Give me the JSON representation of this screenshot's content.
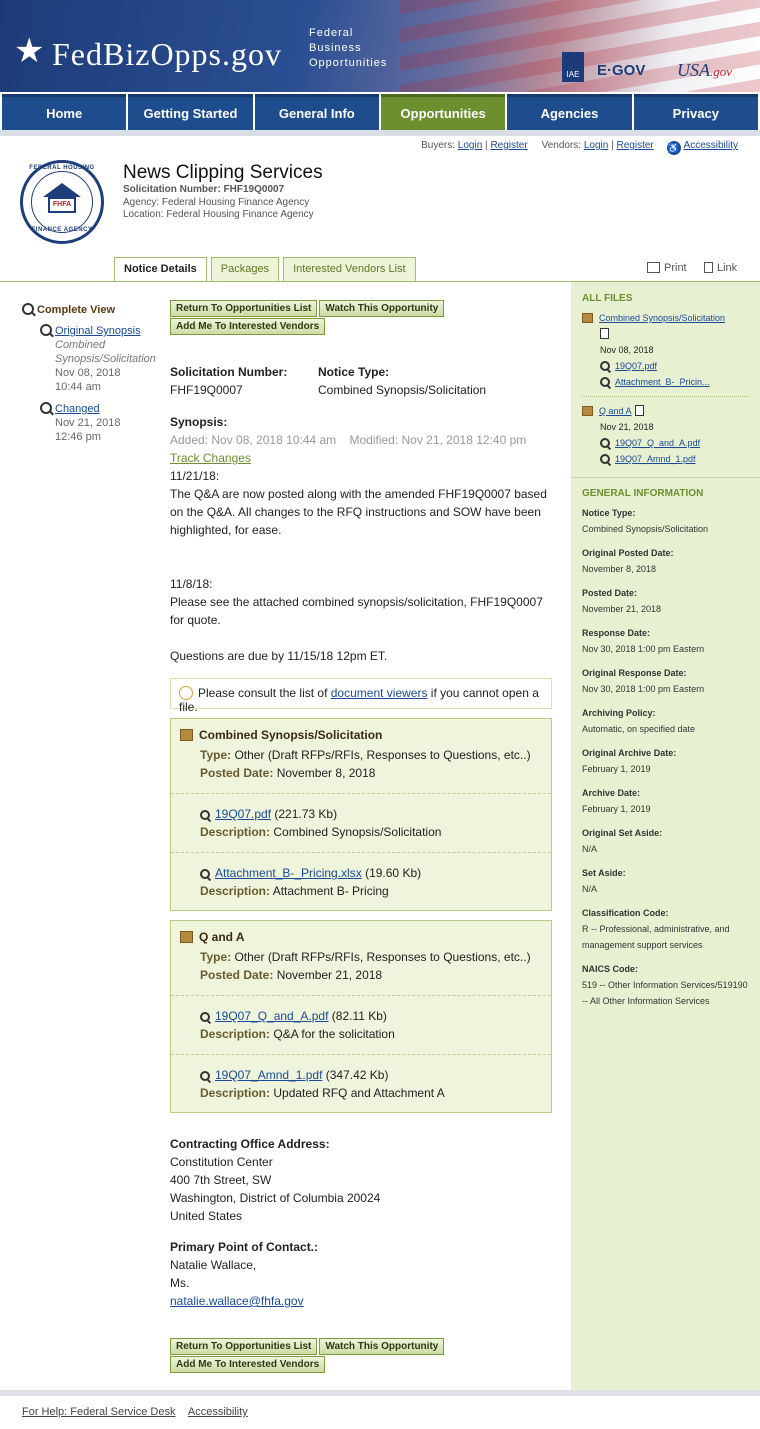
{
  "header": {
    "logo_text": "FedBizOpps.gov",
    "logo_sub": [
      "Federal",
      "Business",
      "Opportunities"
    ],
    "iae": "IAE",
    "egov": "E·GOV",
    "usagov": "USA",
    "usagov_suffix": ".gov",
    "colors": {
      "brand_blue": "#1e4d8e",
      "accent_green": "#6c8f2f"
    }
  },
  "nav": [
    "Home",
    "Getting Started",
    "General Info",
    "Opportunities",
    "Agencies",
    "Privacy"
  ],
  "top_links": {
    "buyers_label": "Buyers:",
    "vendors_label": "Vendors:",
    "login": "Login",
    "register": "Register",
    "sep": "|",
    "accessibility": "Accessibility"
  },
  "notice": {
    "title": "News Clipping Services",
    "solicitation_line": "Solicitation Number: FHF19Q0007",
    "agency_line": "Agency: Federal Housing Finance Agency",
    "location_line": "Location: Federal Housing Finance Agency",
    "seal_top": "FEDERAL HOUSING",
    "seal_bottom": "FINANCE AGENCY",
    "seal_center": "FHFA"
  },
  "tabs": [
    "Notice Details",
    "Packages",
    "Interested Vendors List"
  ],
  "tools": {
    "print": "Print",
    "link": "Link"
  },
  "left": {
    "complete_view": "Complete View",
    "items": [
      {
        "link": "Original Synopsis",
        "sub": "Combined Synopsis/Solicitation",
        "date": "Nov 08, 2018",
        "time": "10:44 am"
      },
      {
        "link": "Changed",
        "date": "Nov 21, 2018",
        "time": "12:46 pm"
      }
    ]
  },
  "buttons": {
    "return": "Return To Opportunities List",
    "watch": "Watch This Opportunity",
    "add": "Add Me To Interested Vendors"
  },
  "main": {
    "sol_label": "Solicitation Number:",
    "sol_value": "FHF19Q0007",
    "type_label": "Notice Type:",
    "type_value": "Combined Synopsis/Solicitation",
    "synopsis_label": "Synopsis:",
    "added": "Added: Nov 08, 2018 10:44 am",
    "modified": "Modified: Nov 21, 2018 12:40 pm",
    "track_changes": "Track Changes",
    "p1_date": "11/21/18:",
    "p1": "The Q&A are now posted along with the amended FHF19Q0007 based on the Q&A. All changes to the RFQ instructions and SOW have been highlighted, for ease.",
    "p2_date": "11/8/18:",
    "p2": "Please see the attached combined synopsis/solicitation, FHF19Q0007 for quote.",
    "p3": "Questions are due by 11/15/18 12pm ET.",
    "tip_before": "Please consult the list of ",
    "tip_link": "document viewers",
    "tip_after": " if you cannot open a file.",
    "packages": [
      {
        "title": "Combined Synopsis/Solicitation",
        "type_label": "Type:",
        "type_value": "Other (Draft RFPs/RFIs, Responses to Questions, etc..)",
        "date_label": "Posted Date:",
        "date_value": "November 8, 2018",
        "files": [
          {
            "name": "19Q07.pdf",
            "size": "(221.73 Kb)",
            "desc_label": "Description:",
            "desc": "Combined Synopsis/Solicitation"
          },
          {
            "name": "Attachment_B-_Pricing.xlsx",
            "size": "(19.60 Kb)",
            "desc_label": "Description:",
            "desc": "Attachment B- Pricing"
          }
        ]
      },
      {
        "title": "Q and A",
        "type_label": "Type:",
        "type_value": "Other (Draft RFPs/RFIs, Responses to Questions, etc..)",
        "date_label": "Posted Date:",
        "date_value": "November 21, 2018",
        "files": [
          {
            "name": "19Q07_Q_and_A.pdf",
            "size": "(82.11 Kb)",
            "desc_label": "Description:",
            "desc": "Q&A for the solicitation"
          },
          {
            "name": "19Q07_Amnd_1.pdf",
            "size": "(347.42 Kb)",
            "desc_label": "Description:",
            "desc": "Updated RFQ and Attachment A"
          }
        ]
      }
    ],
    "office_label": "Contracting Office Address:",
    "office_lines": [
      "Constitution Center",
      "400 7th Street, SW",
      "Washington, District of Columbia 20024",
      "United States"
    ],
    "poc_label": "Primary Point of Contact.:",
    "poc_lines": [
      "Natalie Wallace,",
      "Ms."
    ],
    "poc_email": "natalie.wallace@fhfa.gov"
  },
  "right": {
    "all_files": "ALL FILES",
    "groups": [
      {
        "title": "Combined Synopsis/Solicitation",
        "date": "Nov 08, 2018",
        "files": [
          "19Q07.pdf",
          "Attachment_B-_Pricin..."
        ]
      },
      {
        "title": "Q and A",
        "date": "Nov 21, 2018",
        "files": [
          "19Q07_Q_and_A.pdf",
          "19Q07_Amnd_1.pdf"
        ]
      }
    ],
    "general_info": "GENERAL INFORMATION",
    "info": [
      {
        "label": "Notice Type:",
        "value": "Combined Synopsis/Solicitation"
      },
      {
        "label": "Original Posted Date:",
        "value": "November 8, 2018"
      },
      {
        "label": "Posted Date:",
        "value": "November 21, 2018"
      },
      {
        "label": "Response Date:",
        "value": "Nov 30, 2018 1:00 pm Eastern"
      },
      {
        "label": "Original Response Date:",
        "value": "Nov 30, 2018 1:00 pm Eastern"
      },
      {
        "label": "Archiving Policy:",
        "value": "Automatic, on specified date"
      },
      {
        "label": "Original Archive Date:",
        "value": "February 1, 2019"
      },
      {
        "label": "Archive Date:",
        "value": "February 1, 2019"
      },
      {
        "label": "Original Set Aside:",
        "value": "N/A"
      },
      {
        "label": "Set Aside:",
        "value": "N/A"
      },
      {
        "label": "Classification Code:",
        "value": "R -- Professional, administrative, and management support services"
      },
      {
        "label": "NAICS Code:",
        "value": "519 -- Other Information Services/519190 -- All Other Information Services"
      }
    ]
  },
  "footer": {
    "help": "For Help: Federal Service Desk",
    "accessibility": "Accessibility"
  }
}
